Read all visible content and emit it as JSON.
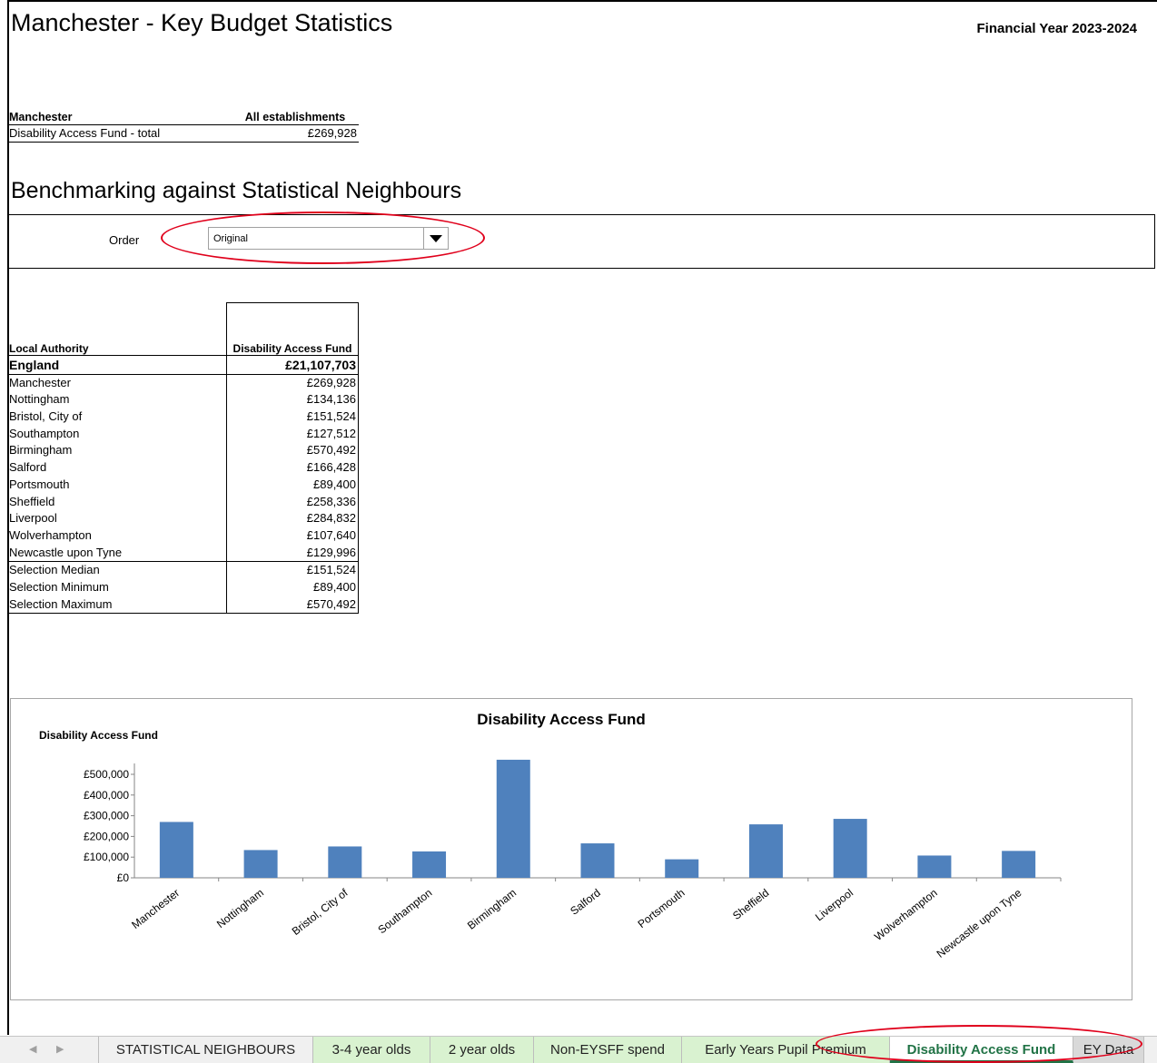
{
  "header": {
    "title": "Manchester - Key Budget Statistics",
    "financial_year": "Financial Year 2023-2024"
  },
  "summary": {
    "col1_header": "Manchester",
    "col2_header": "All establishments",
    "row_label": "Disability Access Fund - total",
    "row_value": "£269,928"
  },
  "benchmark": {
    "title": "Benchmarking against Statistical Neighbours",
    "order_label": "Order",
    "order_value": "Original"
  },
  "table": {
    "col1_header": "Local Authority",
    "col2_header": "Disability Access Fund",
    "england_label": "England",
    "england_value": "£21,107,703",
    "rows": [
      {
        "label": "Manchester",
        "value": "£269,928"
      },
      {
        "label": "Nottingham",
        "value": "£134,136"
      },
      {
        "label": "Bristol, City of",
        "value": "£151,524"
      },
      {
        "label": "Southampton",
        "value": "£127,512"
      },
      {
        "label": "Birmingham",
        "value": "£570,492"
      },
      {
        "label": "Salford",
        "value": "£166,428"
      },
      {
        "label": "Portsmouth",
        "value": "£89,400"
      },
      {
        "label": "Sheffield",
        "value": "£258,336"
      },
      {
        "label": "Liverpool",
        "value": "£284,832"
      },
      {
        "label": "Wolverhampton",
        "value": "£107,640"
      },
      {
        "label": "Newcastle upon Tyne",
        "value": "£129,996"
      }
    ],
    "stats": [
      {
        "label": "Selection Median",
        "value": "£151,524"
      },
      {
        "label": "Selection Minimum",
        "value": "£89,400"
      },
      {
        "label": "Selection Maximum",
        "value": "£570,492"
      }
    ]
  },
  "chart_data": {
    "type": "bar",
    "title": "Disability Access Fund",
    "ylabel": "Disability Access Fund",
    "xlabel": "",
    "categories": [
      "Manchester",
      "Nottingham",
      "Bristol, City of",
      "Southampton",
      "Birmingham",
      "Salford",
      "Portsmouth",
      "Sheffield",
      "Liverpool",
      "Wolverhampton",
      "Newcastle upon Tyne"
    ],
    "values": [
      269928,
      134136,
      151524,
      127512,
      570492,
      166428,
      89400,
      258336,
      284832,
      107640,
      129996
    ],
    "ylim": [
      0,
      500000
    ],
    "yticks": [
      "£0",
      "£100,000",
      "£200,000",
      "£300,000",
      "£400,000",
      "£500,000"
    ],
    "bar_color": "#4f81bd",
    "grid": false,
    "legend": "none"
  },
  "tabs": [
    {
      "label": "STATISTICAL NEIGHBOURS"
    },
    {
      "label": "3-4 year olds"
    },
    {
      "label": "2 year olds"
    },
    {
      "label": "Non-EYSFF spend"
    },
    {
      "label": "Early Years Pupil Premium"
    },
    {
      "label": "Disability Access Fund"
    },
    {
      "label": "EY Data"
    }
  ],
  "colors": {
    "accent_green": "#217346",
    "tab_green": "#d9f2d0",
    "annotation_red": "#e0001b"
  }
}
